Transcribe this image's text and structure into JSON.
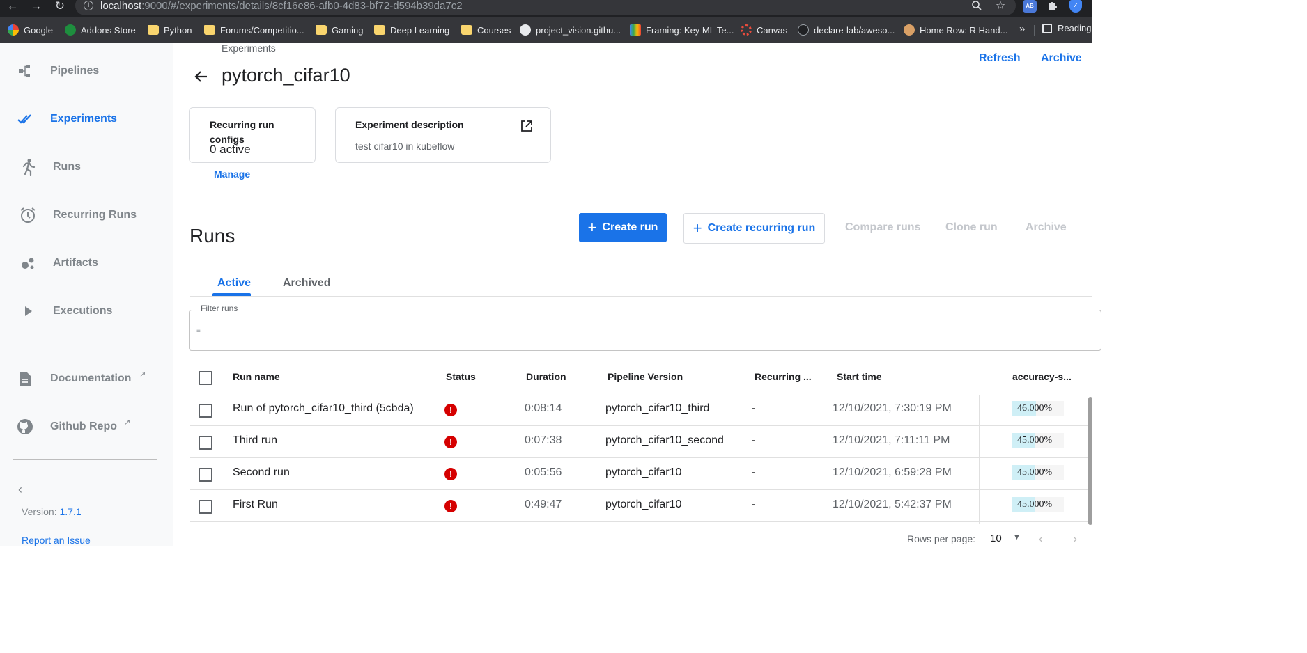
{
  "browser": {
    "url_host": "localhost",
    "url_rest": ":9000/#/experiments/details/8cf16e86-afb0-4d83-bf72-d594b39da7c2",
    "extensions": [
      "zoom-icon",
      "star-icon",
      "AB",
      "puzzle-icon",
      "shield-check-icon"
    ],
    "bookmarks": [
      {
        "label": "Google",
        "icon": "google-icon"
      },
      {
        "label": "Addons Store",
        "icon": "addons-icon"
      },
      {
        "label": "Python",
        "icon": "folder-icon"
      },
      {
        "label": "Forums/Competitio...",
        "icon": "folder-icon"
      },
      {
        "label": "Gaming",
        "icon": "folder-icon"
      },
      {
        "label": "Deep Learning",
        "icon": "folder-icon"
      },
      {
        "label": "Courses",
        "icon": "folder-icon"
      },
      {
        "label": "project_vision.githu...",
        "icon": "globe-icon"
      },
      {
        "label": "Framing: Key ML Te...",
        "icon": "colab-icon"
      },
      {
        "label": "Canvas",
        "icon": "canvas-icon"
      },
      {
        "label": "declare-lab/aweso...",
        "icon": "github-icon"
      },
      {
        "label": "Home Row: R Hand...",
        "icon": "avatar-icon"
      }
    ],
    "more_label": "»",
    "reading_list_label": "Reading"
  },
  "sidebar": {
    "items": [
      {
        "label": "Pipelines",
        "icon": "pipelines-icon",
        "active": false
      },
      {
        "label": "Experiments",
        "icon": "experiments-icon",
        "active": true
      },
      {
        "label": "Runs",
        "icon": "runs-icon",
        "active": false
      },
      {
        "label": "Recurring Runs",
        "icon": "alarm-icon",
        "active": false
      },
      {
        "label": "Artifacts",
        "icon": "artifacts-icon",
        "active": false
      },
      {
        "label": "Executions",
        "icon": "play-icon",
        "active": false
      }
    ],
    "links": [
      {
        "label": "Documentation",
        "icon": "document-icon"
      },
      {
        "label": "Github Repo",
        "icon": "github-icon"
      }
    ],
    "version_label": "Version:",
    "version_value": "1.7.1",
    "report_label": "Report an Issue"
  },
  "header": {
    "breadcrumb": "Experiments",
    "title": "pytorch_cifar10",
    "refresh_label": "Refresh",
    "archive_label": "Archive"
  },
  "cards": {
    "recurring": {
      "title": "Recurring run configs",
      "value": "0 active",
      "manage_label": "Manage"
    },
    "description": {
      "title": "Experiment description",
      "text": "test cifar10 in kubeflow"
    }
  },
  "runs_section": {
    "title": "Runs",
    "create_run_label": "Create run",
    "create_recurring_label": "Create recurring run",
    "compare_label": "Compare runs",
    "clone_label": "Clone run",
    "archive_label": "Archive",
    "tabs": [
      {
        "label": "Active",
        "active": true
      },
      {
        "label": "Archived",
        "active": false
      }
    ],
    "filter_label": "Filter runs"
  },
  "table": {
    "columns": [
      "Run name",
      "Status",
      "Duration",
      "Pipeline Version",
      "Recurring ...",
      "Start time",
      "accuracy-s..."
    ],
    "rows": [
      {
        "name": "Run of pytorch_cifar10_third (5cbda)",
        "status": "error",
        "duration": "0:08:14",
        "pipeline": "pytorch_cifar10_third",
        "recurring": "-",
        "start": "12/10/2021, 7:30:19 PM",
        "metric": "46.000%",
        "metric_value": 0.46
      },
      {
        "name": "Third run",
        "status": "error",
        "duration": "0:07:38",
        "pipeline": "pytorch_cifar10_second",
        "recurring": "-",
        "start": "12/10/2021, 7:11:11 PM",
        "metric": "45.000%",
        "metric_value": 0.45
      },
      {
        "name": "Second run",
        "status": "error",
        "duration": "0:05:56",
        "pipeline": "pytorch_cifar10",
        "recurring": "-",
        "start": "12/10/2021, 6:59:28 PM",
        "metric": "45.000%",
        "metric_value": 0.45
      },
      {
        "name": "First Run",
        "status": "error",
        "duration": "0:49:47",
        "pipeline": "pytorch_cifar10",
        "recurring": "-",
        "start": "12/10/2021, 5:42:37 PM",
        "metric": "45.000%",
        "metric_value": 0.45
      }
    ]
  },
  "pagination": {
    "rows_per_page_label": "Rows per page:",
    "rows_per_page_value": "10"
  },
  "colors": {
    "accent": "#1a73e8",
    "error": "#d50000",
    "metric_fill": "#cfeff6"
  }
}
